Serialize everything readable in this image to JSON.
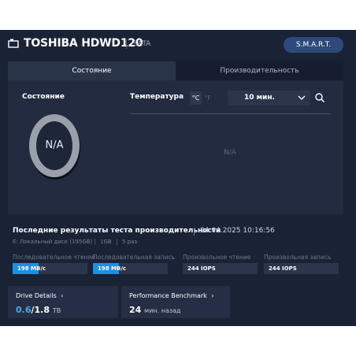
{
  "header": {
    "drive_icon": "drive-icon",
    "title": "TOSHIBA HDWD120",
    "interface": "SATA",
    "smart_label": "S.M.A.R.T."
  },
  "tabs": [
    {
      "label": "Состояние",
      "active": true
    },
    {
      "label": "Производительность",
      "active": false
    }
  ],
  "status": {
    "label": "Состояние",
    "value": "N/A"
  },
  "temperature": {
    "label": "Температура",
    "unit_c": "°C",
    "unit_f": "°F",
    "selected_unit": "°C",
    "interval": "10 мин.",
    "value": "N/A"
  },
  "results": {
    "title": "Последние результаты теста производительности",
    "date": "24.04.2025 10:16:56",
    "disk": "E: Локальный диск (195GB)",
    "size": "1GB",
    "runs": "5 раз",
    "metrics": [
      {
        "label": "Последовательное чтение",
        "value": "198 MB/c",
        "fill": 0.35
      },
      {
        "label": "Последовательная запись",
        "value": "198 MB/c",
        "fill": 0.35
      },
      {
        "label": "Произвольное чтение",
        "value": "244 IOPS",
        "fill": 0
      },
      {
        "label": "Произвольная запись",
        "value": "244 IOPS",
        "fill": 0
      }
    ]
  },
  "tiles": {
    "drive_details": {
      "title": "Drive Details",
      "used": "0.6",
      "total": "/1.8",
      "unit": "TB"
    },
    "benchmark": {
      "title": "Performance Benchmark",
      "value": "24",
      "unit": "мин. назад"
    }
  },
  "colors": {
    "background": "#1a2236",
    "card": "#222b40",
    "accent": "#1f8fe0",
    "smart_button": "#2e4a7a"
  }
}
